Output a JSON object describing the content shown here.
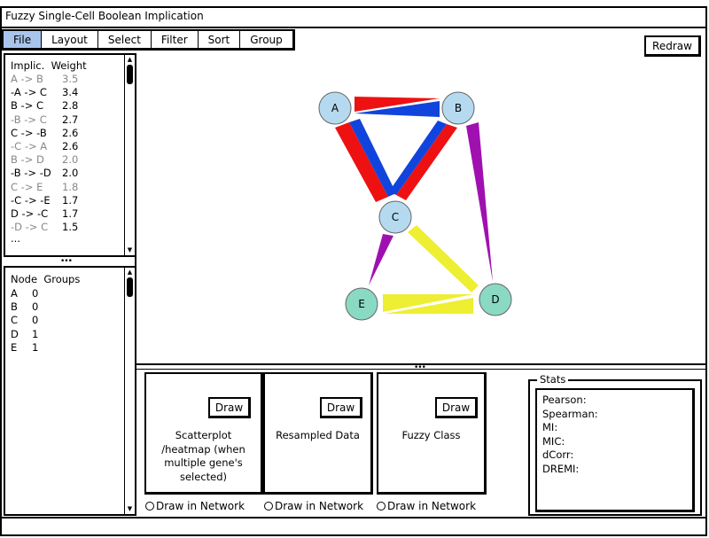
{
  "window": {
    "title": "Fuzzy Single-Cell Boolean Implication"
  },
  "menu": {
    "items": [
      {
        "label": "File",
        "active": true
      },
      {
        "label": "Layout"
      },
      {
        "label": "Select"
      },
      {
        "label": "Filter"
      },
      {
        "label": "Sort"
      },
      {
        "label": "Group"
      }
    ]
  },
  "toolbar": {
    "redraw_label": "Redraw"
  },
  "implications": {
    "header_col1": "Implic.",
    "header_col2": "Weight",
    "rows": [
      {
        "rule": "A -> B",
        "weight": "3.5",
        "muted": true
      },
      {
        "rule": "-A -> C",
        "weight": "3.4"
      },
      {
        "rule": "B -> C",
        "weight": "2.8"
      },
      {
        "rule": "-B -> C",
        "weight": "2.7",
        "muted_prefix": true
      },
      {
        "rule": "C -> -B",
        "weight": "2.6"
      },
      {
        "rule": "-C -> A",
        "weight": "2.6",
        "muted_prefix": true
      },
      {
        "rule": "B -> D",
        "weight": "2.0",
        "muted": true
      },
      {
        "rule": "-B -> -D",
        "weight": "2.0"
      },
      {
        "rule": "C -> E",
        "weight": "1.8",
        "muted": true
      },
      {
        "rule": "-C -> -E",
        "weight": "1.7"
      },
      {
        "rule": "D -> -C",
        "weight": "1.7"
      },
      {
        "rule": "-D -> C",
        "weight": "1.5",
        "muted_prefix": true
      }
    ],
    "more": "..."
  },
  "groups": {
    "header_col1": "Node",
    "header_col2": "Groups",
    "rows": [
      {
        "node": "A",
        "group": "0"
      },
      {
        "node": "B",
        "group": "0"
      },
      {
        "node": "C",
        "group": "0"
      },
      {
        "node": "D",
        "group": "1"
      },
      {
        "node": "E",
        "group": "1"
      }
    ]
  },
  "network": {
    "nodes": [
      {
        "id": "A",
        "color": "#b5daf0"
      },
      {
        "id": "B",
        "color": "#b5daf0"
      },
      {
        "id": "C",
        "color": "#b5daf0"
      },
      {
        "id": "D",
        "color": "#8ad9c3"
      },
      {
        "id": "E",
        "color": "#8ad9c3"
      }
    ],
    "colors": {
      "red": "#ee1111",
      "blue": "#1144dd",
      "purple": "#a010b0",
      "yellow": "#eeee33"
    }
  },
  "cards": [
    {
      "draw_label": "Draw",
      "label_lines": [
        "Scatterplot",
        "/heatmap (when",
        "multiple gene's",
        "selected)"
      ],
      "radio_label": "Draw in Network"
    },
    {
      "draw_label": "Draw",
      "label_lines": [
        "Resampled Data"
      ],
      "radio_label": "Draw in Network"
    },
    {
      "draw_label": "Draw",
      "label_lines": [
        "Fuzzy Class"
      ],
      "radio_label": "Draw in Network"
    }
  ],
  "stats": {
    "title": "Stats",
    "lines": [
      "Pearson:",
      "Spearman:",
      "MI:",
      "MIC:",
      "dCorr:",
      "DREMI:"
    ]
  }
}
